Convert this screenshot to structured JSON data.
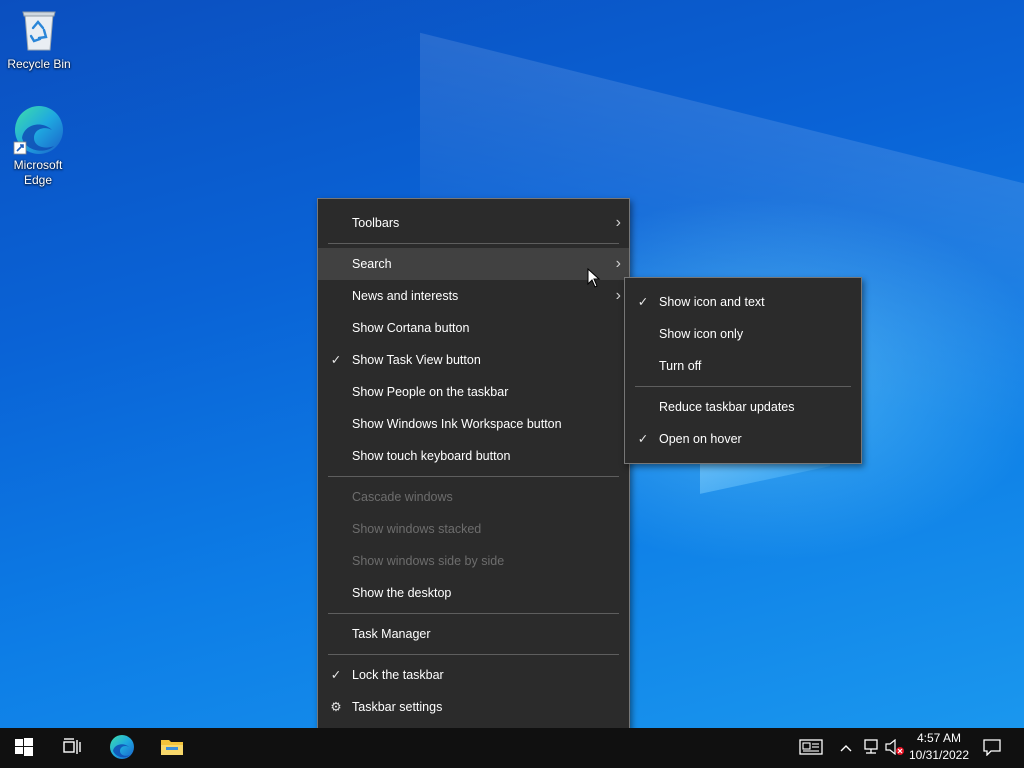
{
  "desktop": {
    "icons": [
      {
        "label": "Recycle Bin",
        "icon": "recycle-bin-icon"
      },
      {
        "label": "Microsoft Edge",
        "icon": "edge-icon"
      }
    ]
  },
  "context_menu": {
    "items": [
      {
        "label": "Toolbars",
        "submenu": true
      },
      {
        "label": "Search",
        "submenu": true,
        "active": true
      },
      {
        "label": "News and interests",
        "submenu": true
      },
      {
        "label": "Show Cortana button"
      },
      {
        "label": "Show Task View button",
        "checked": true
      },
      {
        "label": "Show People on the taskbar"
      },
      {
        "label": "Show Windows Ink Workspace button"
      },
      {
        "label": "Show touch keyboard button"
      },
      {
        "label": "Cascade windows",
        "disabled": true
      },
      {
        "label": "Show windows stacked",
        "disabled": true
      },
      {
        "label": "Show windows side by side",
        "disabled": true
      },
      {
        "label": "Show the desktop"
      },
      {
        "label": "Task Manager"
      },
      {
        "label": "Lock the taskbar",
        "checked": true
      },
      {
        "label": "Taskbar settings",
        "icon": "gear-icon"
      }
    ]
  },
  "submenu": {
    "items": [
      {
        "label": "Show icon and text",
        "checked": true
      },
      {
        "label": "Show icon only"
      },
      {
        "label": "Turn off"
      },
      {
        "label": "Reduce taskbar updates"
      },
      {
        "label": "Open on hover",
        "checked": true
      }
    ]
  },
  "taskbar": {
    "apps": [
      "start-icon",
      "task-view-icon",
      "edge-icon",
      "file-explorer-icon"
    ],
    "tray": {
      "time": "4:57 AM",
      "date": "10/31/2022"
    }
  },
  "colors": {
    "menu_bg": "#2b2b2b",
    "taskbar_bg": "#101010",
    "desktop_accent": "#0a68d0"
  }
}
